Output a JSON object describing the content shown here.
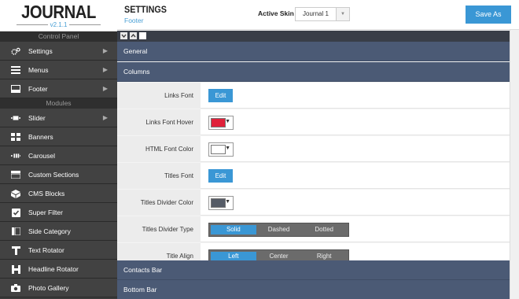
{
  "logo": {
    "title": "JOURNAL",
    "version": "v2.1.1"
  },
  "sidebar": {
    "control_panel_header": "Control Panel",
    "control_items": [
      {
        "label": "Settings",
        "icon": "cogs-icon",
        "has_submenu": true
      },
      {
        "label": "Menus",
        "icon": "menu-icon",
        "has_submenu": true
      },
      {
        "label": "Footer",
        "icon": "footer-icon",
        "has_submenu": true
      }
    ],
    "modules_header": "Modules",
    "module_items": [
      {
        "label": "Slider",
        "icon": "slider-icon",
        "has_submenu": true
      },
      {
        "label": "Banners",
        "icon": "banners-icon",
        "has_submenu": false
      },
      {
        "label": "Carousel",
        "icon": "carousel-icon",
        "has_submenu": false
      },
      {
        "label": "Custom Sections",
        "icon": "custom-sections-icon",
        "has_submenu": false
      },
      {
        "label": "CMS Blocks",
        "icon": "cms-blocks-icon",
        "has_submenu": false
      },
      {
        "label": "Super Filter",
        "icon": "checkbox-icon",
        "has_submenu": false
      },
      {
        "label": "Side Category",
        "icon": "side-category-icon",
        "has_submenu": false
      },
      {
        "label": "Text Rotator",
        "icon": "text-icon",
        "has_submenu": false
      },
      {
        "label": "Headline Rotator",
        "icon": "headline-icon",
        "has_submenu": false
      },
      {
        "label": "Photo Gallery",
        "icon": "camera-icon",
        "has_submenu": false
      }
    ]
  },
  "header": {
    "title": "SETTINGS",
    "subtitle": "Footer",
    "active_skin_label": "Active Skin",
    "active_skin_value": "Journal 1",
    "save_as_label": "Save As"
  },
  "sections": {
    "general": "General",
    "columns": "Columns",
    "contacts_bar": "Contacts Bar",
    "bottom_bar": "Bottom Bar"
  },
  "rows": {
    "links_font": {
      "label": "Links Font",
      "button": "Edit"
    },
    "links_font_hover": {
      "label": "Links Font Hover",
      "color": "#e0213a"
    },
    "html_font_color": {
      "label": "HTML Font Color",
      "color": "#ffffff"
    },
    "titles_font": {
      "label": "Titles Font",
      "button": "Edit"
    },
    "titles_divider_color": {
      "label": "Titles Divider Color",
      "color": "#555b66"
    },
    "titles_divider_type": {
      "label": "Titles Divider Type",
      "options": [
        "Solid",
        "Dashed",
        "Dotted"
      ],
      "selected": "Solid"
    },
    "title_align": {
      "label": "Title Align",
      "options": [
        "Left",
        "Center",
        "Right"
      ],
      "selected": "Left"
    }
  },
  "colors": {
    "accent": "#3a97d5",
    "section_bar": "#4b5a75",
    "sidebar": "#424242"
  }
}
